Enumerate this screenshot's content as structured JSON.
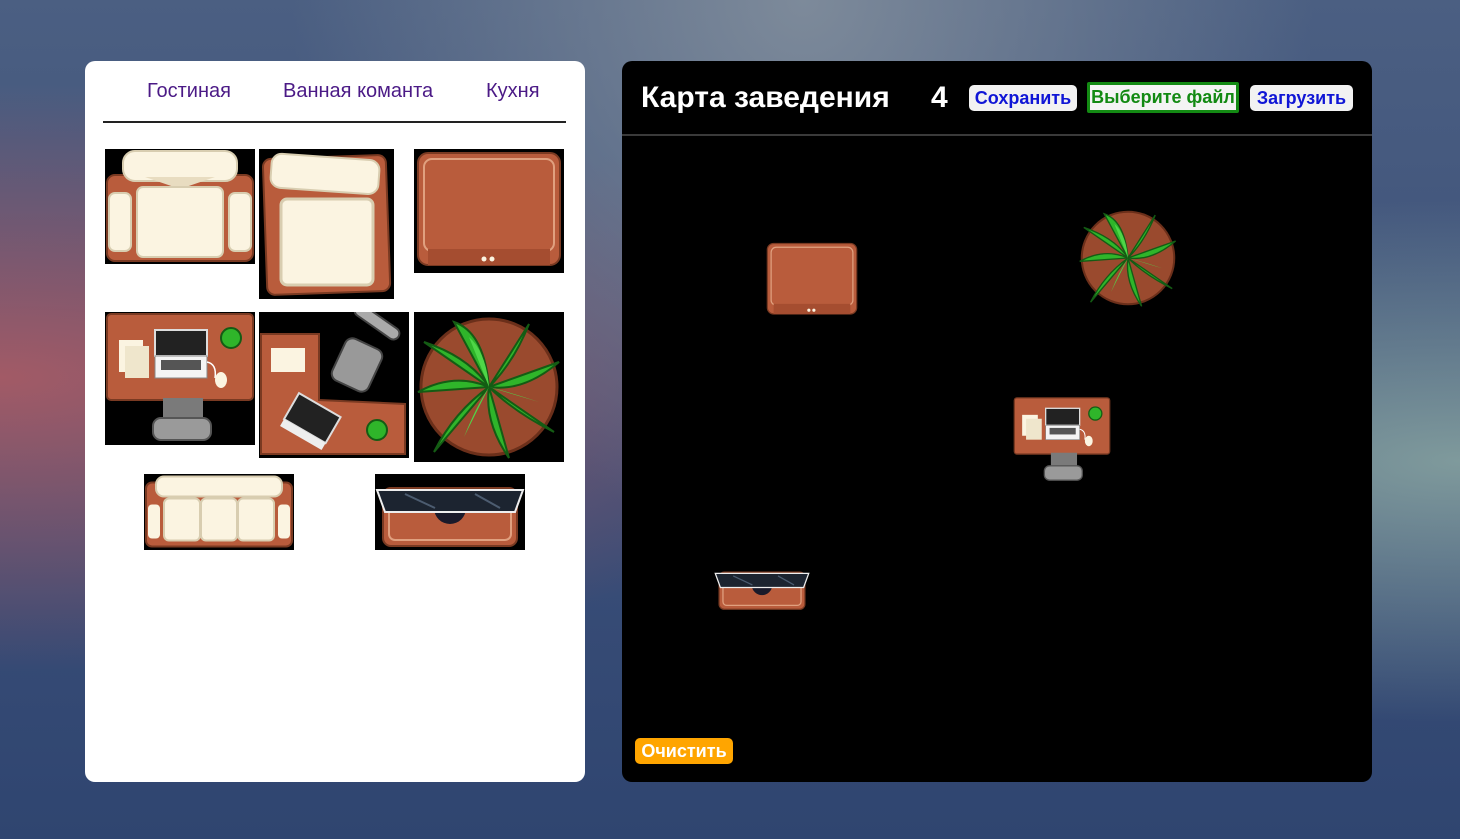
{
  "catalog": {
    "tabs": [
      {
        "label": "Гостиная"
      },
      {
        "label": "Ванная команта"
      },
      {
        "label": "Кухня"
      }
    ],
    "items": [
      {
        "icon": "armchair-icon"
      },
      {
        "icon": "armchair-rotated-icon"
      },
      {
        "icon": "table-icon"
      },
      {
        "icon": "desk-with-laptop-icon"
      },
      {
        "icon": "corner-desk-icon"
      },
      {
        "icon": "plant-icon"
      },
      {
        "icon": "sofa-icon"
      },
      {
        "icon": "tv-stand-icon"
      }
    ]
  },
  "map": {
    "title": "Карта заведения",
    "count": "4",
    "save_label": "Сохранить",
    "file_label": "Выберите файл",
    "load_label": "Загрузить",
    "clear_label": "Очистить",
    "placed_items": [
      {
        "icon": "table-icon"
      },
      {
        "icon": "plant-icon"
      },
      {
        "icon": "desk-with-laptop-icon"
      },
      {
        "icon": "tv-stand-icon"
      }
    ]
  },
  "colors": {
    "wood": "#b95c3c",
    "cushion": "#fbf4e1",
    "leaf": "#2fb52a",
    "accent_orange": "#ffa500",
    "button_blue": "#1016d6",
    "file_green": "#138a13",
    "tab_purple": "#4b1a86"
  }
}
